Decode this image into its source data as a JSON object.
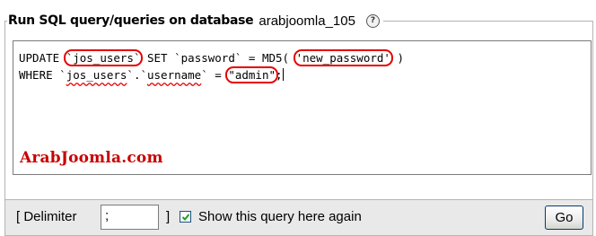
{
  "legend": {
    "title": "Run SQL query/queries on database",
    "database": "arabjoomla_105",
    "help_icon": "help-icon"
  },
  "query": {
    "line1": {
      "p1": "UPDATE ",
      "table": "`jos_users`",
      "p2": " SET `password` = MD5( ",
      "value": "'new_password'",
      "p3": " )"
    },
    "line2": {
      "p1": "WHERE `",
      "table": "jos_users",
      "p2": "`.`",
      "column": "username",
      "p3": "` = ",
      "value": "\"admin\"",
      "p4": ";"
    }
  },
  "watermark": "ArabJoomla.com",
  "footer": {
    "delimiter_open": "[ Delimiter",
    "delimiter_value": ";",
    "delimiter_close": "]",
    "show_query_checked": true,
    "show_query_label": "Show this query here again",
    "go_label": "Go"
  },
  "colors": {
    "highlight": "#e60000",
    "watermark": "#c80000",
    "footer_bg": "#e9e9e9"
  }
}
